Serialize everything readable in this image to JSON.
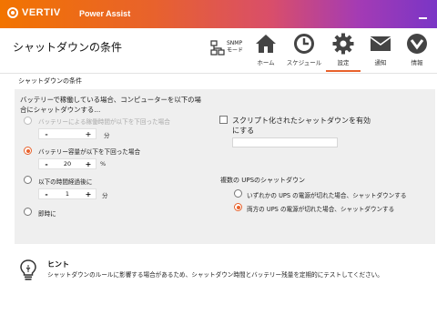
{
  "header": {
    "logo_text": "VERTIV",
    "app_name": "Power Assist"
  },
  "page": {
    "title": "シャットダウンの条件"
  },
  "toolbar": {
    "snmp_label_1": "SNMP",
    "snmp_label_2": "モード",
    "nav": [
      {
        "label": "ホーム",
        "icon": "home-icon"
      },
      {
        "label": "スケジュール",
        "icon": "clock-icon"
      },
      {
        "label": "設定",
        "icon": "gear-icon",
        "active": true
      },
      {
        "label": "通知",
        "icon": "mail-icon"
      },
      {
        "label": "情報",
        "icon": "info-chevron-icon"
      }
    ],
    "accent_color": "#e8622c"
  },
  "conditions": {
    "section_title": "シャットダウンの条件",
    "description": "バッテリーで稼働している場合、コンピューターを以下の場合にシャットダウンする...",
    "options": [
      {
        "label": "バッテリーによる稼働時間が以下を下回った場合",
        "disabled": true,
        "checked": false,
        "value": "",
        "unit": "分"
      },
      {
        "label": "バッテリー容量が以下を下回った場合",
        "disabled": false,
        "checked": true,
        "value": "20",
        "unit": "%"
      },
      {
        "label": "以下の時間経過後に",
        "disabled": false,
        "checked": false,
        "value": "1",
        "unit": "分"
      },
      {
        "label": "即時に",
        "disabled": false,
        "checked": false
      }
    ],
    "minus": "-",
    "plus": "+"
  },
  "script": {
    "label": "スクリプト化されたシャットダウンを有効にする",
    "checked": false,
    "input_value": ""
  },
  "multi_ups": {
    "title": "複数の UPSのシャットダウン",
    "options": [
      {
        "label": "いずれかの UPS の電源が切れた場合、シャットダウンする",
        "checked": false
      },
      {
        "label": "両方の UPS の電源が切れた場合、シャットダウンする",
        "checked": true
      }
    ]
  },
  "hint": {
    "title": "ヒント",
    "text": "シャットダウンのルールに影響する場合があるため、シャットダウン時間とバッテリー残量を定期的にテストしてください。"
  }
}
